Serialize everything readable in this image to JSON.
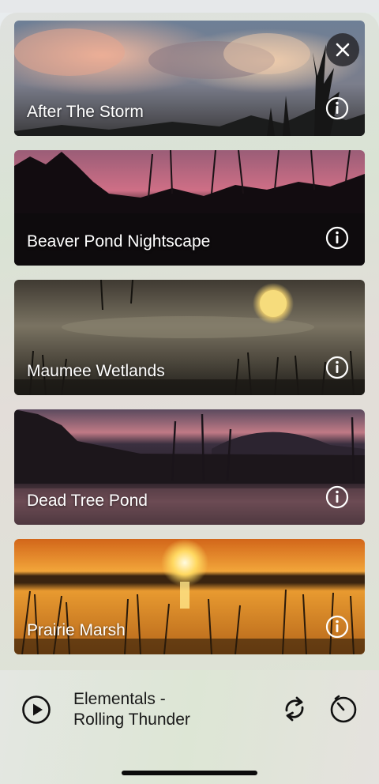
{
  "scenes": [
    {
      "title": "After The Storm",
      "info_icon": "info-circle-icon"
    },
    {
      "title": "Beaver Pond Nightscape",
      "info_icon": "info-circle-icon"
    },
    {
      "title": "Maumee Wetlands",
      "info_icon": "info-circle-icon"
    },
    {
      "title": "Dead Tree Pond",
      "info_icon": "info-circle-icon"
    },
    {
      "title": "Prairie Marsh",
      "info_icon": "info-circle-icon"
    }
  ],
  "close_icon": "close-icon",
  "player": {
    "track_line1": "Elementals -",
    "track_line2": "Rolling Thunder",
    "play_icon": "play-icon",
    "repeat_icon": "repeat-icon",
    "timer_icon": "timer-icon"
  },
  "colors": {
    "overlay_text": "#ffffff",
    "player_text": "#1a1a1a",
    "close_bg": "#2a2a2d"
  }
}
